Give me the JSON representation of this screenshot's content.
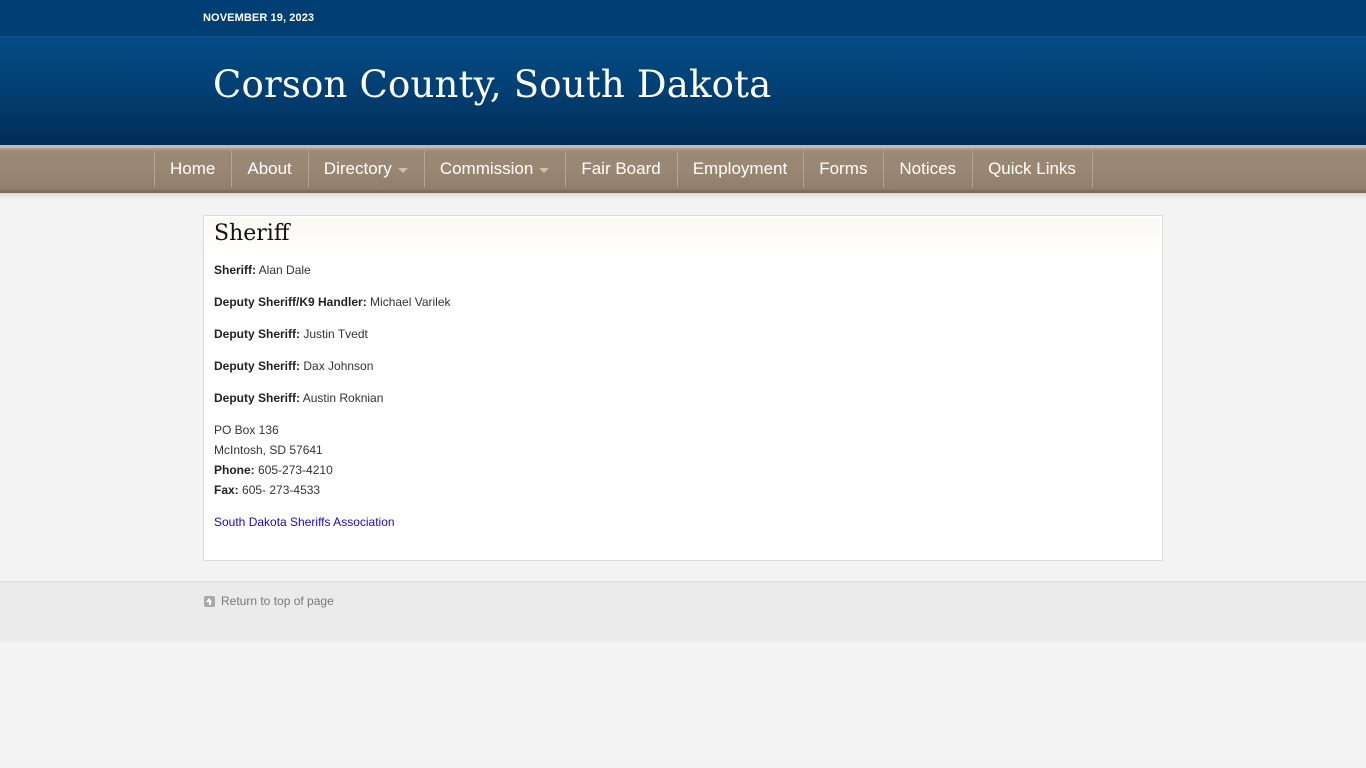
{
  "topbar": {
    "date": "NOVEMBER 19, 2023"
  },
  "header": {
    "site_title": "Corson County, South Dakota"
  },
  "nav": {
    "items": [
      {
        "label": "Home",
        "has_dropdown": false
      },
      {
        "label": "About",
        "has_dropdown": false
      },
      {
        "label": "Directory",
        "has_dropdown": true
      },
      {
        "label": "Commission",
        "has_dropdown": true
      },
      {
        "label": "Fair Board",
        "has_dropdown": false
      },
      {
        "label": "Employment",
        "has_dropdown": false
      },
      {
        "label": "Forms",
        "has_dropdown": false
      },
      {
        "label": "Notices",
        "has_dropdown": false
      },
      {
        "label": "Quick Links",
        "has_dropdown": false
      }
    ]
  },
  "page": {
    "title": "Sheriff",
    "staff": [
      {
        "role": "Sheriff:",
        "name": "Alan Dale"
      },
      {
        "role": "Deputy Sheriff/K9 Handler:",
        "name": "Michael Varilek"
      },
      {
        "role": "Deputy Sheriff:",
        "name": "Justin Tvedt"
      },
      {
        "role": "Deputy Sheriff:",
        "name": "Dax Johnson"
      },
      {
        "role": "Deputy Sheriff:",
        "name": "Austin Roknian"
      }
    ],
    "address": {
      "line1": "PO Box 136",
      "line2": "McIntosh, SD 57641",
      "phone_label": "Phone:",
      "phone": "605-273-4210",
      "fax_label": "Fax:",
      "fax": "605- 273-4533"
    },
    "link": "South Dakota Sheriffs Association"
  },
  "footer": {
    "back_to_top": "Return to top of page"
  },
  "colors": {
    "topbar": "#003e74",
    "header": "#023f72",
    "nav": "#9a8875",
    "link": "#1a0dab"
  }
}
